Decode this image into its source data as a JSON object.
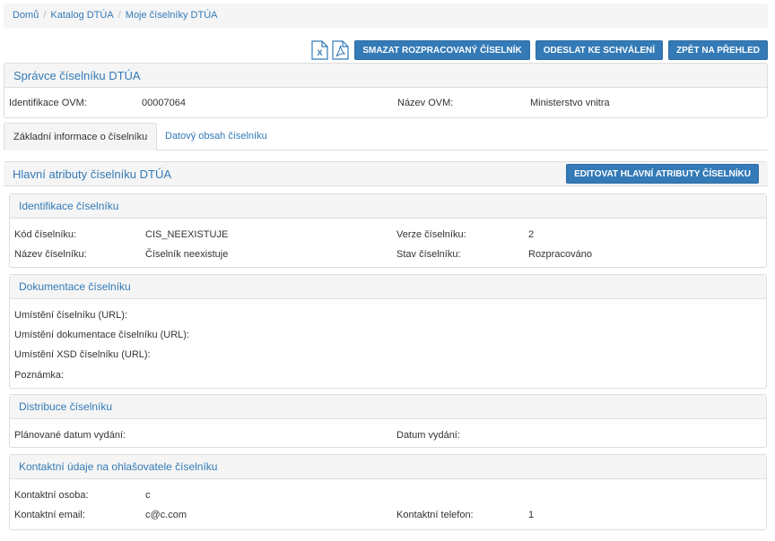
{
  "breadcrumb": [
    "Domů",
    "Katalog DTÚA",
    "Moje číselníky DTÚA"
  ],
  "toolbar": {
    "excel_icon_letter": "X",
    "delete_button": "SMAZAT ROZPRACOVANÝ ČÍSELNÍK",
    "submit_button": "ODESLAT KE SCHVÁLENÍ",
    "back_button": "ZPĚT NA PŘEHLED"
  },
  "admin": {
    "title": "Správce číselníku DTÚA",
    "id_label": "Identifikace OVM:",
    "id_value": "00007064",
    "name_label": "Název OVM:",
    "name_value": "Ministerstvo vnitra"
  },
  "tabs": {
    "basic": "Základní informace o číselníku",
    "data": "Datový obsah číselníku"
  },
  "main": {
    "title": "Hlavní atributy číselníku DTÚA",
    "edit_button": "EDITOVAT HLAVNÍ ATRIBUTY ČÍSELNÍKU"
  },
  "identification": {
    "title": "Identifikace číselníku",
    "code_label": "Kód číselníku:",
    "code_value": "CIS_NEEXISTUJE",
    "version_label": "Verze číselníku:",
    "version_value": "2",
    "name_label": "Název číselníku:",
    "name_value": "Číselník neexistuje",
    "state_label": "Stav číselníku:",
    "state_value": "Rozpracováno"
  },
  "documentation": {
    "title": "Dokumentace číselníku",
    "url_label": "Umístění číselníku (URL):",
    "doc_url_label": "Umístění dokumentace číselníku (URL):",
    "xsd_url_label": "Umístění XSD číselníku (URL):",
    "note_label": "Poznámka:"
  },
  "distribution": {
    "title": "Distribuce číselníku",
    "planned_label": "Plánované datum vydání:",
    "date_label": "Datum vydání:"
  },
  "contact": {
    "title": "Kontaktní údaje na ohlašovatele číselníku",
    "person_label": "Kontaktní osoba:",
    "person_value": "c",
    "email_label": "Kontaktní email:",
    "email_value": "c@c.com",
    "phone_label": "Kontaktní telefon:",
    "phone_value": "1"
  },
  "colors": {
    "primary": "#337ab7",
    "heading_bg": "#f5f5f5",
    "border": "#dddddd"
  }
}
